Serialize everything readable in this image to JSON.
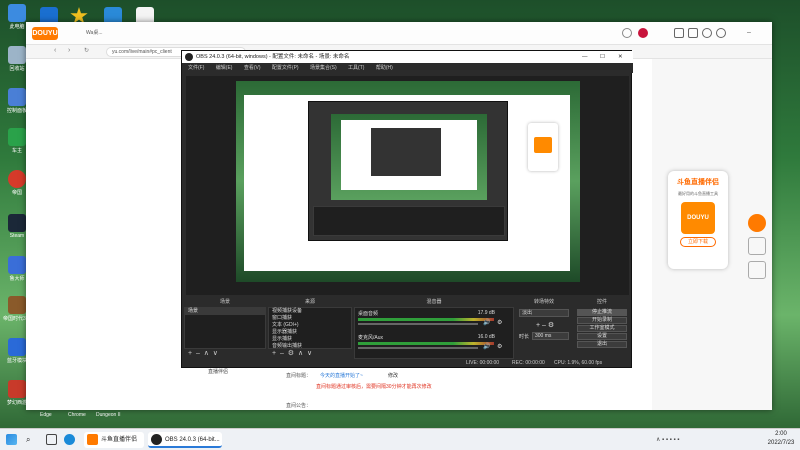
{
  "desktop": {
    "icons": [
      {
        "label": "此电脑",
        "color": "#3c8be0"
      },
      {
        "label": "回收站",
        "color": "#9cb4c8"
      },
      {
        "label": "控制面板",
        "color": "#4a7fd6"
      },
      {
        "label": "车主",
        "color": "#2aa24a"
      },
      {
        "label": "帝国",
        "color": "#d63a2a"
      },
      {
        "label": "Steam",
        "color": "#1b2838"
      },
      {
        "label": "鲁大师",
        "color": "#3a6ed8"
      },
      {
        "label": "帝国时代3：权力帝国",
        "color": "#8a5a2a"
      },
      {
        "label": "蓝牙模块",
        "color": "#2a6ad8"
      },
      {
        "label": "梦幻西游",
        "color": "#c83a2a"
      }
    ],
    "bottom_labels": [
      "Edge",
      "Chrome",
      "Dungeon II"
    ]
  },
  "browser": {
    "tab_title": "斗鱼 ...",
    "tab_label": "Wa桌...",
    "url": "yu.com/live/main#pc_client",
    "promo": {
      "title": "斗鱼直播伴侣",
      "subtitle": "最好用的斗鱼直播工具",
      "logo_text": "DOUYU",
      "button": "立即下载"
    },
    "content": {
      "tab": "直播伴侣",
      "row1_label": "直间标题：",
      "row1_link": "今天的直播开始了~",
      "row1_edit": "修改",
      "warning": "直间标题通过审核后，需要间隔30分钟才能再次修改",
      "row2_label": "直间公告："
    }
  },
  "obs": {
    "title": "OBS 24.0.3 (64-bit, windows) - 配置文件: 未命名 - 场景: 未命名",
    "menu": [
      "文件(F)",
      "编辑(E)",
      "查看(V)",
      "配置文件(P)",
      "场景集合(S)",
      "工具(T)",
      "帮助(H)"
    ],
    "panels": {
      "scenes": "场景",
      "sources": "来源",
      "mixer": "混音器",
      "transitions": "转场特效",
      "controls": "控件"
    },
    "scene_items": [
      "场景"
    ],
    "source_items": [
      "视频捕获设备",
      "窗口捕获",
      "文本 (GDI+)",
      "显示器捕获",
      "显示捕获",
      "音频输出捕获"
    ],
    "mixer": [
      {
        "name": "桌面音频",
        "db": "17.9 dB"
      },
      {
        "name": "麦克风/Aux",
        "db": "16.0 dB"
      }
    ],
    "transition": {
      "type": "淡出",
      "duration_label": "时长",
      "duration": "300 ms"
    },
    "controls": [
      "停止推流",
      "开始录制",
      "工作室模式",
      "设置",
      "退出"
    ],
    "status": {
      "live": "LIVE: 00:00:00",
      "rec": "REC: 00:00:00",
      "cpu": "CPU: 1.9%, 60.00 fps"
    }
  },
  "taskbar": {
    "apps": [
      {
        "label": "斗鱼直播伴侣",
        "color": "#ff7a00"
      },
      {
        "label": "OBS 24.0.3 (64-bit...",
        "color": "#222222"
      }
    ],
    "time": "2:00",
    "date": "2022/7/23"
  }
}
